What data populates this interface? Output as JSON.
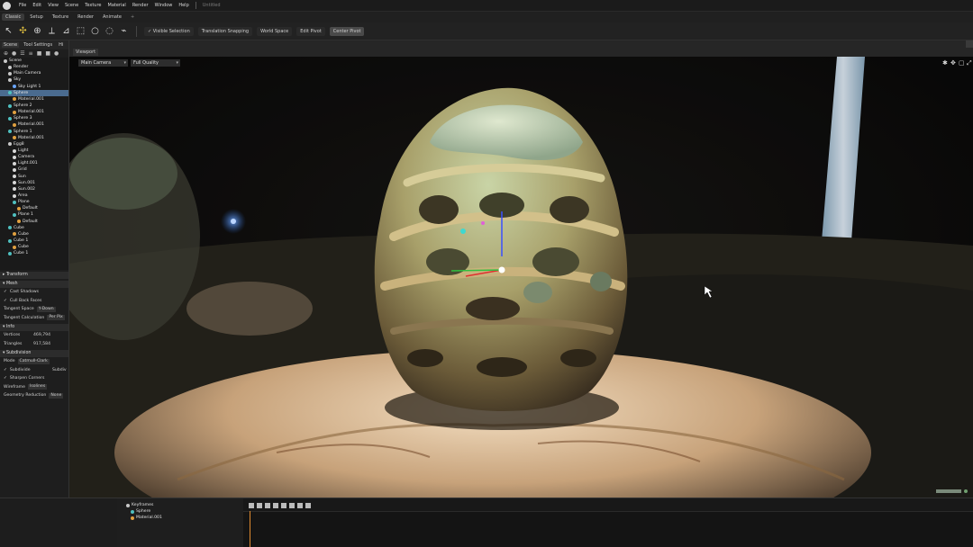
{
  "menu": [
    "File",
    "Edit",
    "View",
    "Scene",
    "Texture",
    "Material",
    "Render",
    "Window",
    "Help"
  ],
  "doc_title": "Untitled",
  "workspace_tabs": [
    "Classic",
    "Setup",
    "Texture",
    "Render",
    "Animate"
  ],
  "toolbar": {
    "visible_selection": "Visible Selection",
    "translation_snapping": "Translation Snapping",
    "world_space": "World Space",
    "edit_pivot": "Edit Pivot",
    "center_pivot": "Center Pivot"
  },
  "panel_tabs": [
    "Scene",
    "Tool Settings",
    "Hi"
  ],
  "tree": [
    {
      "label": "Scene",
      "level": 0,
      "color": "#c8c8c8"
    },
    {
      "label": "Render",
      "level": 1,
      "color": "#c8c8c8"
    },
    {
      "label": "Main Camera",
      "level": 1,
      "color": "#c8c8c8"
    },
    {
      "label": "Sky",
      "level": 1,
      "color": "#c8c8c8"
    },
    {
      "label": "Sky Light 1",
      "level": 2,
      "color": "#6aa6ff"
    },
    {
      "label": "Sphere",
      "level": 1,
      "color": "#4fc0c0",
      "selected": true
    },
    {
      "label": "Material.001",
      "level": 2,
      "color": "#e0a040"
    },
    {
      "label": "Sphere 2",
      "level": 1,
      "color": "#4fc0c0"
    },
    {
      "label": "Material.001",
      "level": 2,
      "color": "#e0a040"
    },
    {
      "label": "Sphere 3",
      "level": 1,
      "color": "#4fc0c0"
    },
    {
      "label": "Material.001",
      "level": 2,
      "color": "#e0a040"
    },
    {
      "label": "Sphere 1",
      "level": 1,
      "color": "#4fc0c0"
    },
    {
      "label": "Material.001",
      "level": 2,
      "color": "#e0a040"
    },
    {
      "label": "Egg8",
      "level": 1,
      "color": "#c8c8c8"
    },
    {
      "label": "Light",
      "level": 2,
      "color": "#d8d8d8"
    },
    {
      "label": "Camera",
      "level": 2,
      "color": "#d8d8d8"
    },
    {
      "label": "Light.001",
      "level": 2,
      "color": "#d8d8d8"
    },
    {
      "label": "Grid",
      "level": 2,
      "color": "#d8d8d8"
    },
    {
      "label": "Sun",
      "level": 2,
      "color": "#d8d8d8"
    },
    {
      "label": "Sun.001",
      "level": 2,
      "color": "#d8d8d8"
    },
    {
      "label": "Sun.002",
      "level": 2,
      "color": "#d8d8d8"
    },
    {
      "label": "Area",
      "level": 2,
      "color": "#d8d8d8"
    },
    {
      "label": "Plane",
      "level": 2,
      "color": "#4fc0c0"
    },
    {
      "label": "Default",
      "level": 3,
      "color": "#e0a040"
    },
    {
      "label": "Plane 1",
      "level": 2,
      "color": "#4fc0c0"
    },
    {
      "label": "Default",
      "level": 3,
      "color": "#e0a040"
    },
    {
      "label": "Cube",
      "level": 1,
      "color": "#4fc0c0"
    },
    {
      "label": "Cube",
      "level": 2,
      "color": "#e0a040"
    },
    {
      "label": "Cube 1",
      "level": 1,
      "color": "#4fc0c0"
    },
    {
      "label": "Cube",
      "level": 2,
      "color": "#e0a040"
    },
    {
      "label": "Cube 1",
      "level": 1,
      "color": "#4fc0c0"
    }
  ],
  "props": {
    "transform_header": "Transform",
    "mesh_header": "Mesh",
    "cast_shadows": "Cast Shadows",
    "cull_back_faces": "Cull Back Faces",
    "tangent_space": "Tangent Space",
    "tangent_space_value": "Y-Down",
    "tangent_calculation": "Tangent Calculation",
    "tangent_calculation_value": "Per Pix",
    "info_header": "Info",
    "vertices_label": "Vertices",
    "vertices_value": "469,794",
    "triangles_label": "Triangles",
    "triangles_value": "917,584",
    "subdivision_header": "Subdivision",
    "mode_label": "Mode",
    "mode_value": "Catmull-Clark",
    "subdivide_label": "Subdivide",
    "subdivide_value": "Subdiv",
    "sharpen_corners": "Sharpen Corners",
    "wireframe_label": "Wireframe",
    "wireframe_value": "Isolines",
    "geometry_reduction_label": "Geometry Reduction",
    "geometry_reduction_value": "None"
  },
  "viewport": {
    "tab": "Viewport",
    "camera": "Main Camera",
    "quality": "Full Quality"
  },
  "timeline": {
    "tree": [
      {
        "label": "Keyframes",
        "color": "#c8c8c8"
      },
      {
        "label": "Sphere",
        "color": "#4fc0c0"
      },
      {
        "label": "Material.001",
        "color": "#e0a040"
      }
    ]
  }
}
